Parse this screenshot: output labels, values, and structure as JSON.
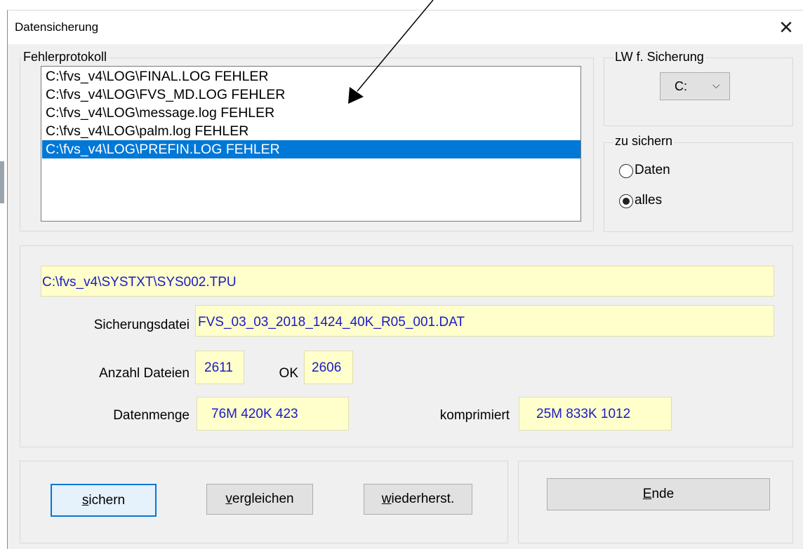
{
  "window": {
    "title": "Datensicherung",
    "close_symbol": "✕"
  },
  "fehlerprotokoll": {
    "legend": "Fehlerprotokoll",
    "items": [
      "C:\\fvs_v4\\LOG\\FINAL.LOG FEHLER",
      "C:\\fvs_v4\\LOG\\FVS_MD.LOG FEHLER",
      "C:\\fvs_v4\\LOG\\message.log FEHLER",
      "C:\\fvs_v4\\LOG\\palm.log FEHLER",
      "C:\\fvs_v4\\LOG\\PREFIN.LOG FEHLER"
    ],
    "selected_index": 4
  },
  "laufwerk": {
    "legend": "LW f. Sicherung",
    "value": "C:",
    "chevron": "⌵"
  },
  "zu_sichern": {
    "legend": "zu sichern",
    "option_daten": "Daten",
    "option_alles": "alles",
    "selected": "alles"
  },
  "info": {
    "current_file": "C:\\fvs_v4\\SYSTXT\\SYS002.TPU",
    "sicherungsdatei_label": "Sicherungsdatei",
    "sicherungsdatei_value": "FVS_03_03_2018_1424_40K_R05_001.DAT",
    "anzahl_label": "Anzahl Dateien",
    "anzahl_value": "2611",
    "ok_label": "OK",
    "ok_value": "2606",
    "datenmenge_label": "Datenmenge",
    "datenmenge_value": "76M 420K 423",
    "komprimiert_label": "komprimiert",
    "komprimiert_value": "25M 833K 1012"
  },
  "buttons": {
    "sichern": {
      "mnemonic": "s",
      "rest": "ichern"
    },
    "vergleichen": {
      "mnemonic": "v",
      "rest": "ergleichen"
    },
    "wiederherst": {
      "mnemonic": "w",
      "rest": "iederherst."
    },
    "ende": {
      "mnemonic": "E",
      "rest": "nde"
    }
  }
}
